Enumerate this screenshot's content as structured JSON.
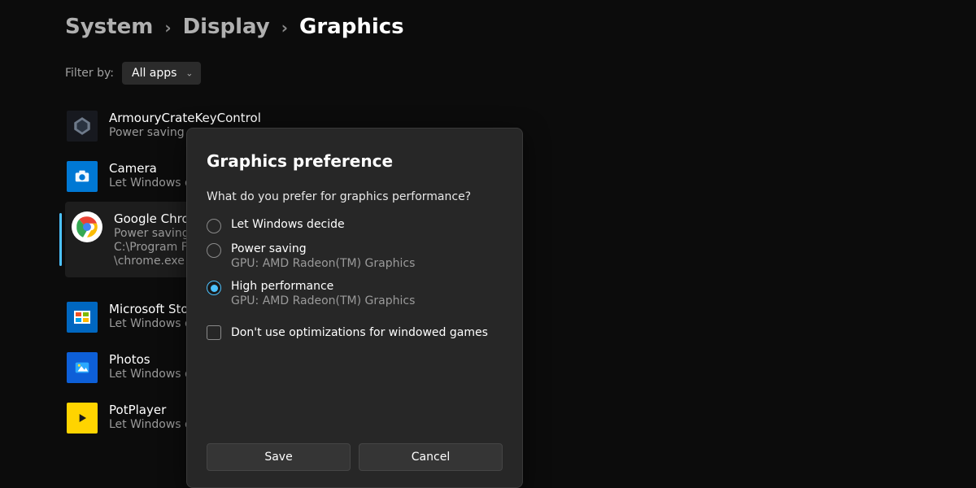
{
  "breadcrumb": {
    "level1": "System",
    "level2": "Display",
    "level3": "Graphics"
  },
  "filter": {
    "label": "Filter by:",
    "value": "All apps"
  },
  "apps": [
    {
      "name": "ArmouryCrateKeyControl",
      "pref": "Power saving"
    },
    {
      "name": "Camera",
      "pref": "Let Windows decide"
    },
    {
      "name": "Google Chrome",
      "pref": "Power saving",
      "path1": "C:\\Program Files\\Google\\Chrome\\Application",
      "path2": "\\chrome.exe"
    },
    {
      "name": "Microsoft Store",
      "pref": "Let Windows decide"
    },
    {
      "name": "Photos",
      "pref": "Let Windows decide"
    },
    {
      "name": "PotPlayer",
      "pref": "Let Windows decide (Power saving)"
    }
  ],
  "dialog": {
    "title": "Graphics preference",
    "subtitle": "What do you prefer for graphics performance?",
    "options": [
      {
        "label": "Let Windows decide",
        "sub": ""
      },
      {
        "label": "Power saving",
        "sub": "GPU: AMD Radeon(TM) Graphics"
      },
      {
        "label": "High performance",
        "sub": "GPU: AMD Radeon(TM) Graphics"
      }
    ],
    "selected_index": 2,
    "checkbox_label": "Don't use optimizations for windowed games",
    "checkbox_checked": false,
    "save_label": "Save",
    "cancel_label": "Cancel"
  }
}
